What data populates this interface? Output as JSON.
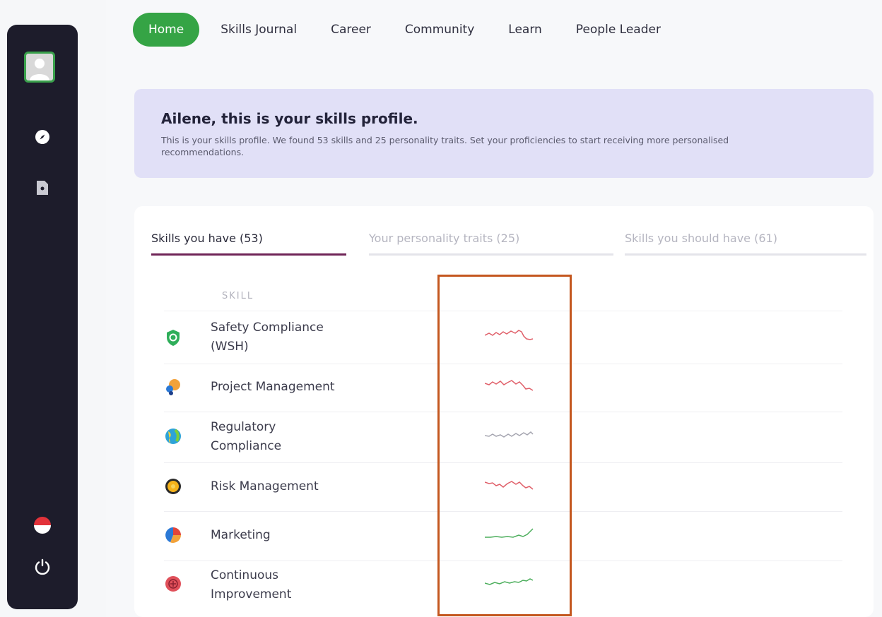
{
  "nav": {
    "items": [
      "Home",
      "Skills Journal",
      "Career",
      "Community",
      "Learn",
      "People Leader"
    ],
    "active": "Home"
  },
  "sidebar": {
    "icons": [
      "avatar",
      "compass-icon",
      "document-icon",
      "flag-icon",
      "power-icon"
    ]
  },
  "banner": {
    "title": "Ailene, this is your skills profile.",
    "text": "This is your skills profile. We found 53 skills and 25 personality traits. Set your proficiencies to start receiving more personalised recommendations."
  },
  "tabs": [
    {
      "label": "Skills you have (53)",
      "active": true
    },
    {
      "label": "Your personality traits (25)",
      "active": false
    },
    {
      "label": "Skills you should have (61)",
      "active": false
    }
  ],
  "table": {
    "column_header": "SKILL",
    "rows": [
      {
        "name_lines": [
          "Safety Compliance",
          "(WSH)"
        ],
        "icon": "shield-icon",
        "trend": "down",
        "trend_color": "#e0606a"
      },
      {
        "name_lines": [
          "Project Management"
        ],
        "icon": "project-icon",
        "trend": "down",
        "trend_color": "#e0606a"
      },
      {
        "name_lines": [
          "Regulatory",
          "Compliance"
        ],
        "icon": "globe-icon",
        "trend": "flat",
        "trend_color": "#a5a5b0"
      },
      {
        "name_lines": [
          "Risk Management"
        ],
        "icon": "risk-icon",
        "trend": "down",
        "trend_color": "#e0606a"
      },
      {
        "name_lines": [
          "Marketing"
        ],
        "icon": "pie-chart-icon",
        "trend": "up",
        "trend_color": "#4cae5c"
      },
      {
        "name_lines": [
          "Continuous",
          "Improvement"
        ],
        "icon": "plus-circle-icon",
        "trend": "up",
        "trend_color": "#4cae5c"
      }
    ]
  },
  "colors": {
    "accent_green": "#35a445",
    "sidebar_bg": "#1d1c2b",
    "banner_bg": "#e1e0f7",
    "active_tab": "#6f2457",
    "highlight_box": "#c4571f"
  }
}
